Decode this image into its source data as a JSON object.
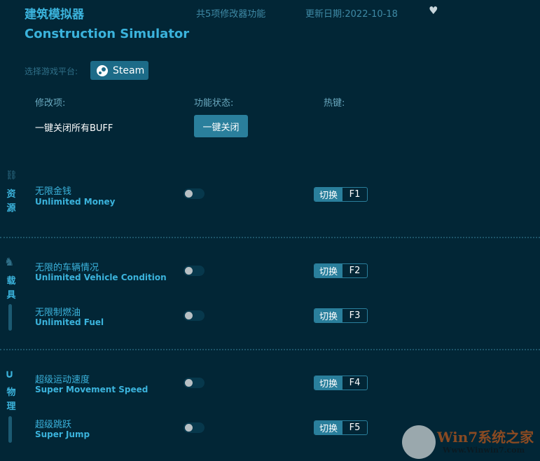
{
  "header": {
    "title_cn": "建筑模拟器",
    "title_en": "Construction Simulator",
    "feature_count": "共5项修改器功能",
    "update_date": "更新日期:2022-10-18"
  },
  "platform": {
    "label": "选择游戏平台:",
    "value": "Steam"
  },
  "columns": {
    "item": "修改项:",
    "status": "功能状态:",
    "hotkey": "热键:"
  },
  "master": {
    "label": "一键关闭所有BUFF",
    "button": "一键关闭"
  },
  "categories": [
    {
      "name1": "资",
      "name2": "源"
    },
    {
      "name1": "载",
      "name2": "具"
    },
    {
      "name1": "物",
      "name2": "理"
    }
  ],
  "toggle_label": "切换",
  "items": [
    {
      "cn": "无限金钱",
      "en": "Unlimited Money",
      "key": "F1",
      "on": false
    },
    {
      "cn": "无限的车辆情况",
      "en": "Unlimited Vehicle Condition",
      "key": "F2",
      "on": false
    },
    {
      "cn": "无限制燃油",
      "en": "Unlimited Fuel",
      "key": "F3",
      "on": false
    },
    {
      "cn": "超级运动速度",
      "en": "Super Movement Speed",
      "key": "F4",
      "on": false
    },
    {
      "cn": "超级跳跃",
      "en": "Super Jump",
      "key": "F5",
      "on": false
    }
  ],
  "watermark": {
    "brand": "Win7系统之家",
    "url": "Www.Winwin7.com"
  }
}
